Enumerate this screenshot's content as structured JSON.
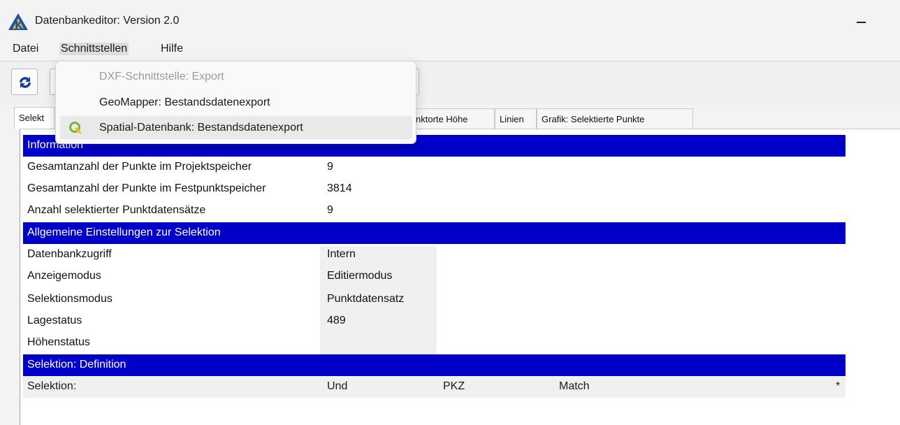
{
  "window": {
    "title": "Datenbankeditor: Version 2.0",
    "minimize_icon": "minimize-icon"
  },
  "menubar": {
    "items": [
      {
        "label": "Datei"
      },
      {
        "label": "Schnittstellen"
      },
      {
        "label": "Hilfe"
      }
    ]
  },
  "dropdown": {
    "items": [
      {
        "label": "DXF-Schnittstelle: Export",
        "enabled": false
      },
      {
        "label": "GeoMapper: Bestandsdatenexport",
        "enabled": true
      },
      {
        "label": "Spatial-Datenbank: Bestandsdatenexport",
        "enabled": true,
        "icon": "qgis-icon",
        "highlighted": true
      }
    ]
  },
  "toolbar": {
    "refresh_icon": "refresh-icon"
  },
  "tabs": [
    {
      "label": "Selekt",
      "active": true
    },
    {
      "label": "nktorte Höhe"
    },
    {
      "label": "Linien"
    },
    {
      "label": "Grafik: Selektierte Punkte"
    }
  ],
  "sections": {
    "information": {
      "title": "Information",
      "rows": [
        {
          "label": "Gesamtanzahl der Punkte im Projektspeicher",
          "value": "9"
        },
        {
          "label": "Gesamtanzahl der Punkte im Festpunktspeicher",
          "value": "3814"
        },
        {
          "label": "Anzahl selektierter Punktdatensätze",
          "value": "9"
        }
      ]
    },
    "settings": {
      "title": "Allgemeine Einstellungen zur Selektion",
      "rows": [
        {
          "label": "Datenbankzugriff",
          "value": "Intern"
        },
        {
          "label": "Anzeigemodus",
          "value": "Editiermodus"
        },
        {
          "label": "Selektionsmodus",
          "value": "Punktdatensatz"
        },
        {
          "label": "Lagestatus",
          "value": "489"
        },
        {
          "label": "Höhenstatus",
          "value": ""
        }
      ]
    },
    "definition": {
      "title": "Selektion: Definition",
      "row": {
        "label": "Selektion:",
        "op": "Und",
        "field": "PKZ",
        "mode": "Match",
        "pattern": "*"
      }
    }
  },
  "colors": {
    "section_bar": "#0000c8",
    "window_bg": "#f3f3f3"
  }
}
